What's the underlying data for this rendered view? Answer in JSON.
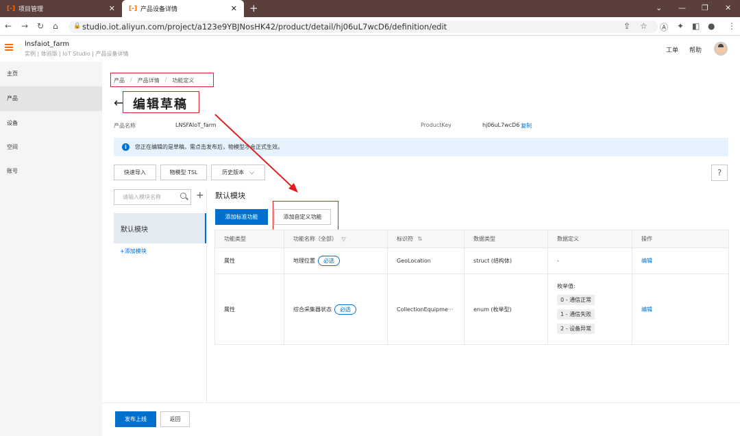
{
  "browser": {
    "tabs": [
      {
        "logo": "[-]",
        "title": "项目管理"
      },
      {
        "logo": "[-]",
        "title": "产品设备详情"
      }
    ],
    "url": "studio.iot.aliyun.com/project/a123e9YBJNosHK42/product/detail/hj06uL7wcD6/definition/edit"
  },
  "header": {
    "app_name": "lnsfaiot_farm",
    "sub": "实例 | 体验版 | IoT Studio | 产品设备详情",
    "links": [
      "工单",
      "帮助"
    ]
  },
  "sidebar": {
    "items": [
      {
        "label": "主页"
      },
      {
        "label": "产品",
        "active": true
      },
      {
        "label": "设备"
      },
      {
        "label": "空间"
      },
      {
        "label": "账号"
      }
    ]
  },
  "breadcrumb": [
    "产品",
    "产品详情",
    "功能定义"
  ],
  "page_title": "编辑草稿",
  "product": {
    "name_label": "产品名称",
    "name": "LNSFAIoT_farm",
    "key_label": "ProductKey",
    "key": "hj06uL7wcD6",
    "copy": "复制"
  },
  "notice": "您正在编辑的是草稿，需点击发布后，物模型才会正式生效。",
  "toolbar": {
    "quick_import": "快速导入",
    "tsl": "物模型 TSL",
    "history": "历史版本",
    "help": "?"
  },
  "modules": {
    "search_placeholder": "请输入模块名称",
    "selected": "默认模块",
    "add": "+添加模块"
  },
  "module_title": "默认模块",
  "actions": {
    "add_standard": "添加标准功能",
    "add_custom": "添加自定义功能"
  },
  "table": {
    "headers": [
      "功能类型",
      "功能名称（全部）",
      "标识符",
      "数据类型",
      "数据定义",
      "操作"
    ],
    "rows": [
      {
        "type": "属性",
        "name": "地理位置",
        "tag": "必选",
        "identifier": "GeoLocation",
        "dtype": "struct (结构体)",
        "def": "-",
        "op": "编辑"
      },
      {
        "type": "属性",
        "name": "综合采集器状态",
        "tag": "必选",
        "identifier": "CollectionEquipme···",
        "dtype": "enum (枚举型)",
        "def_label": "枚举值:",
        "enums": [
          "0 - 通信正常",
          "1 - 通信失败",
          "2 - 设备异常"
        ],
        "op": "编辑"
      }
    ]
  },
  "footer": {
    "publish": "发布上线",
    "back": "返回"
  },
  "colors": {
    "accent": "#0070cc",
    "brand": "#ff6a00",
    "annotation": "#e02020",
    "tabbar": "#5a3f3a"
  }
}
